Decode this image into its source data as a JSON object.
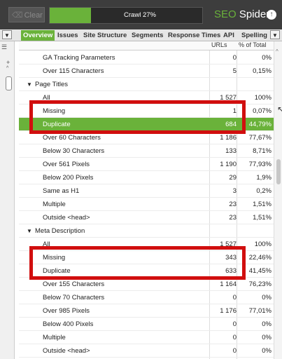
{
  "toolbar": {
    "clear_label": "Clear",
    "crawl_label": "Crawl 27%",
    "crawl_progress": 0.27,
    "brand_seo": "SEO",
    "brand_spider": " Spider"
  },
  "tabs": [
    "Overview",
    "Issues",
    "Site Structure",
    "Segments",
    "Response Times",
    "API",
    "Spelling"
  ],
  "active_tab": "Overview",
  "table": {
    "columns": [
      "URLs",
      "% of Total"
    ],
    "rows": [
      {
        "label": "GA Tracking Parameters",
        "urls": "0",
        "pct": "0%"
      },
      {
        "label": "Over 115 Characters",
        "urls": "5",
        "pct": "0,15%"
      },
      {
        "label": "Page Titles",
        "urls": "",
        "pct": ""
      },
      {
        "label": "All",
        "urls": "1 527",
        "pct": "100%"
      },
      {
        "label": "Missing",
        "urls": "1",
        "pct": "0,07%"
      },
      {
        "label": "Duplicate",
        "urls": "684",
        "pct": "44,79%"
      },
      {
        "label": "Over 60 Characters",
        "urls": "1 186",
        "pct": "77,67%"
      },
      {
        "label": "Below 30 Characters",
        "urls": "133",
        "pct": "8,71%"
      },
      {
        "label": "Over 561 Pixels",
        "urls": "1 190",
        "pct": "77,93%"
      },
      {
        "label": "Below 200 Pixels",
        "urls": "29",
        "pct": "1,9%"
      },
      {
        "label": "Same as H1",
        "urls": "3",
        "pct": "0,2%"
      },
      {
        "label": "Multiple",
        "urls": "23",
        "pct": "1,51%"
      },
      {
        "label": "Outside <head>",
        "urls": "23",
        "pct": "1,51%"
      },
      {
        "label": "Meta Description",
        "urls": "",
        "pct": ""
      },
      {
        "label": "All",
        "urls": "1 527",
        "pct": "100%"
      },
      {
        "label": "Missing",
        "urls": "343",
        "pct": "22,46%"
      },
      {
        "label": "Duplicate",
        "urls": "633",
        "pct": "41,45%"
      },
      {
        "label": "Over 155 Characters",
        "urls": "1 164",
        "pct": "76,23%"
      },
      {
        "label": "Below 70 Characters",
        "urls": "0",
        "pct": "0%"
      },
      {
        "label": "Over 985 Pixels",
        "urls": "1 176",
        "pct": "77,01%"
      },
      {
        "label": "Below 400 Pixels",
        "urls": "0",
        "pct": "0%"
      },
      {
        "label": "Multiple",
        "urls": "0",
        "pct": "0%"
      },
      {
        "label": "Outside <head>",
        "urls": "0",
        "pct": "0%"
      }
    ]
  },
  "colors": {
    "accent": "#6ab23a",
    "callout": "#d10e0e",
    "toolbar_bg": "#3d3d3d"
  }
}
